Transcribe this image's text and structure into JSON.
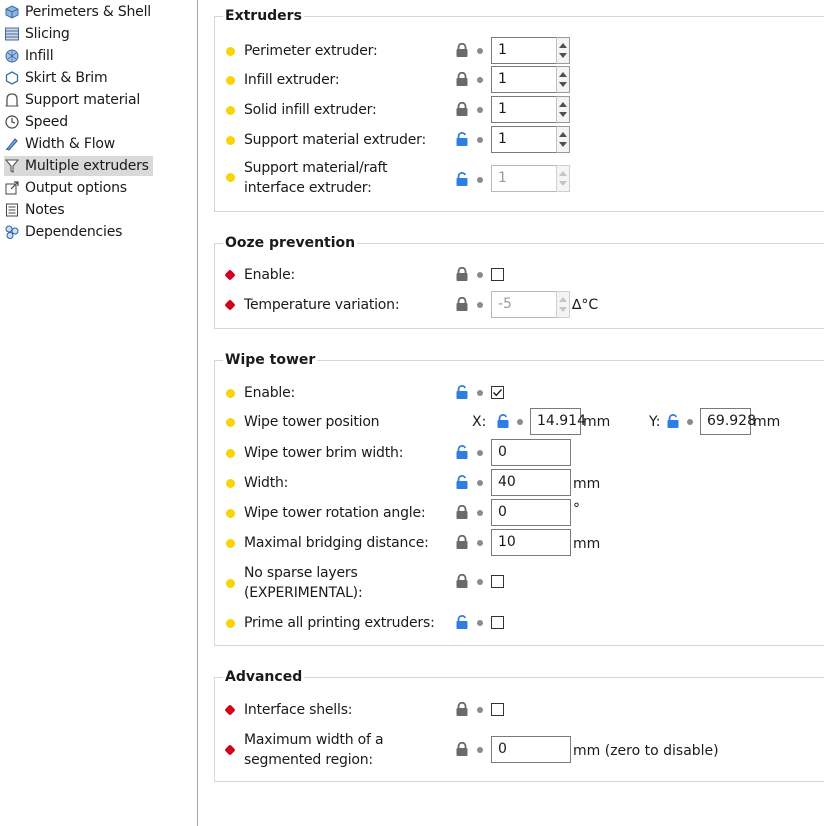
{
  "sidebar": {
    "items": [
      {
        "label": "Perimeters & Shell",
        "icon": "perimeters-icon"
      },
      {
        "label": "Slicing",
        "icon": "slicing-icon"
      },
      {
        "label": "Infill",
        "icon": "infill-icon"
      },
      {
        "label": "Skirt & Brim",
        "icon": "skirt-icon"
      },
      {
        "label": "Support material",
        "icon": "support-icon"
      },
      {
        "label": "Speed",
        "icon": "speed-icon"
      },
      {
        "label": "Width & Flow",
        "icon": "width-flow-icon"
      },
      {
        "label": "Multiple extruders",
        "icon": "funnel-icon",
        "selected": true
      },
      {
        "label": "Output options",
        "icon": "output-icon"
      },
      {
        "label": "Notes",
        "icon": "notes-icon"
      },
      {
        "label": "Dependencies",
        "icon": "dependencies-icon"
      }
    ]
  },
  "colors": {
    "simple_mode": "#f8d400",
    "expert_mode": "#d4001a",
    "unlocked": "#2e7de1",
    "locked": "#6a6a6a"
  },
  "extruders": {
    "title": "Extruders",
    "perimeter": {
      "label": "Perimeter extruder:",
      "value": "1",
      "lock": "locked"
    },
    "infill": {
      "label": "Infill extruder:",
      "value": "1",
      "lock": "locked"
    },
    "solid_infill": {
      "label": "Solid infill extruder:",
      "value": "1",
      "lock": "locked"
    },
    "support": {
      "label": "Support material extruder:",
      "value": "1",
      "lock": "unlocked"
    },
    "interface": {
      "label_line1": "Support material/raft",
      "label_line2": "interface extruder:",
      "value": "1",
      "lock": "unlocked",
      "disabled": true
    }
  },
  "ooze": {
    "title": "Ooze prevention",
    "enable": {
      "label": "Enable:",
      "checked": false,
      "lock": "locked"
    },
    "temp": {
      "label": "Temperature variation:",
      "value": "-5",
      "unit": "∆°C",
      "lock": "locked",
      "disabled": true
    }
  },
  "wipe": {
    "title": "Wipe tower",
    "enable": {
      "label": "Enable:",
      "checked": true,
      "lock": "unlocked"
    },
    "position": {
      "label": "Wipe tower position",
      "x_label": "X:",
      "x_value": "14.914",
      "y_label": "Y:",
      "y_value": "69.928",
      "unit": "mm"
    },
    "brim": {
      "label": "Wipe tower brim width:",
      "value": "0",
      "lock": "unlocked"
    },
    "width": {
      "label": "Width:",
      "value": "40",
      "unit": "mm",
      "lock": "unlocked"
    },
    "rotation": {
      "label": "Wipe tower rotation angle:",
      "value": "0",
      "unit": "°",
      "lock": "locked"
    },
    "bridging": {
      "label": "Maximal bridging distance:",
      "value": "10",
      "unit": "mm",
      "lock": "locked"
    },
    "sparse": {
      "label_line1": "No sparse layers",
      "label_line2": "(EXPERIMENTAL):",
      "checked": false,
      "lock": "locked"
    },
    "prime": {
      "label": "Prime all printing extruders:",
      "checked": false,
      "lock": "unlocked"
    }
  },
  "advanced": {
    "title": "Advanced",
    "shells": {
      "label": "Interface shells:",
      "checked": false,
      "lock": "locked"
    },
    "segmented": {
      "label_line1": "Maximum width of a",
      "label_line2": "segmented region:",
      "value": "0",
      "unit": "mm (zero to disable)",
      "lock": "locked"
    }
  }
}
